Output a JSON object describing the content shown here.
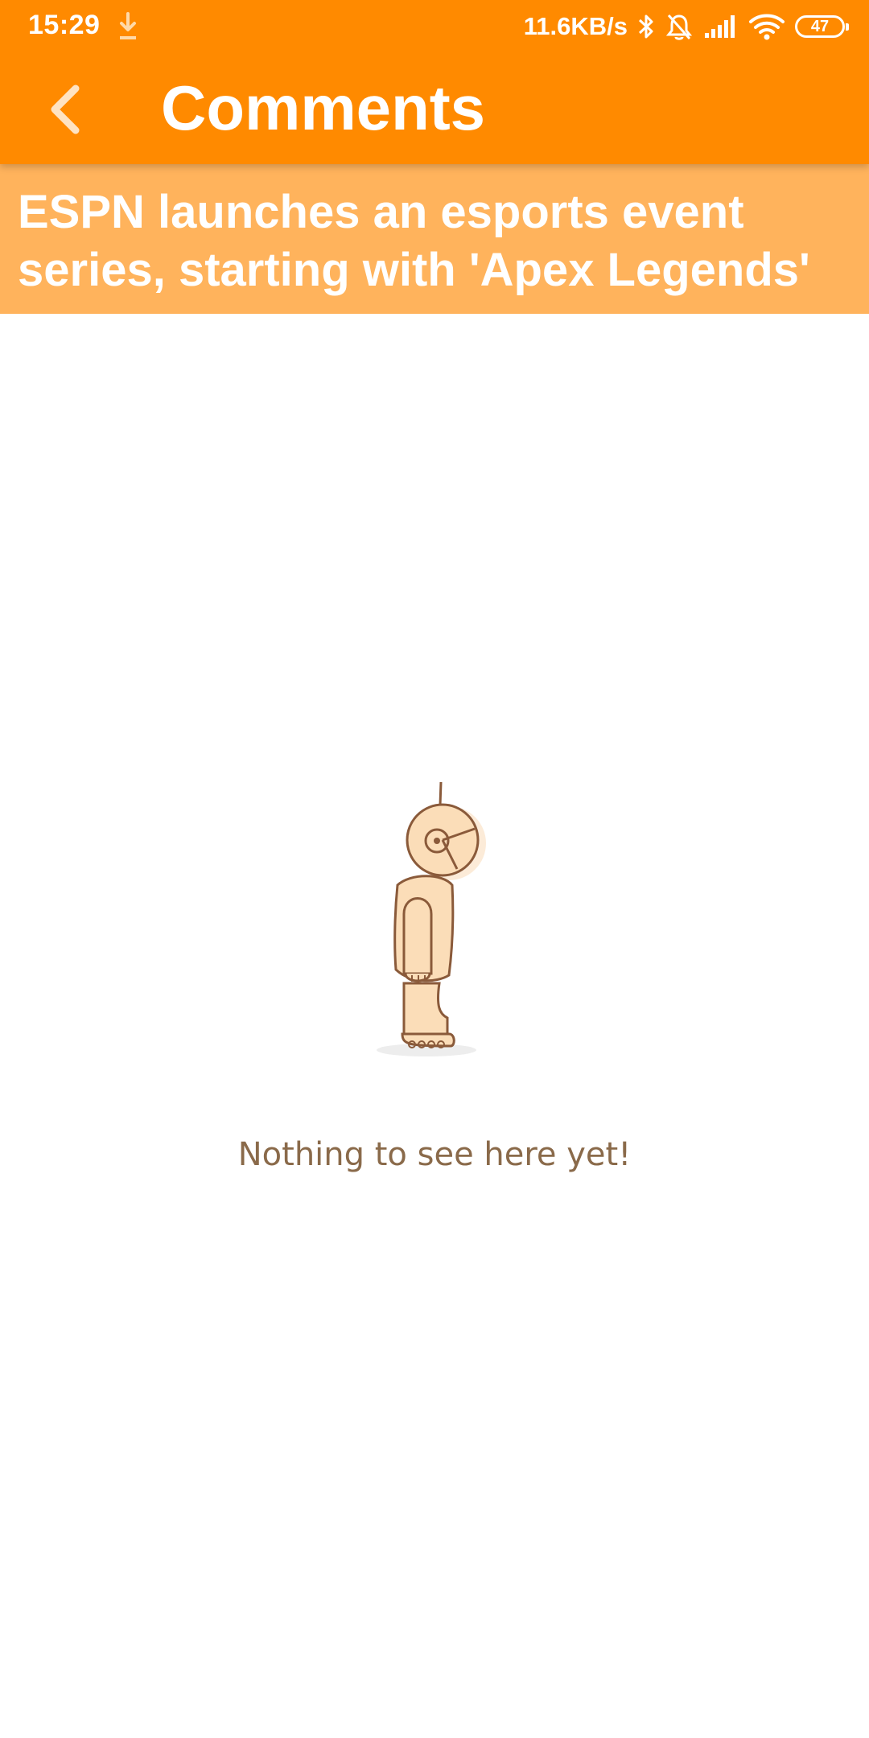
{
  "status_bar": {
    "time": "15:29",
    "network_speed": "11.6KB/s",
    "battery": "47",
    "icons": [
      "download-icon",
      "bluetooth-icon",
      "notifications-off-icon",
      "signal-icon",
      "wifi-icon",
      "battery-icon"
    ]
  },
  "app_bar": {
    "title": "Comments",
    "back_icon": "chevron-left-icon"
  },
  "article": {
    "headline": "ESPN launches an esports event series, starting with 'Apex Legends'"
  },
  "empty_state": {
    "message": "Nothing to see here yet!",
    "illustration": "astronaut-illustration"
  },
  "colors": {
    "app_bar": "#FF8A00",
    "headline_band": "#FFB35C",
    "message_text": "#8A6A4A"
  }
}
